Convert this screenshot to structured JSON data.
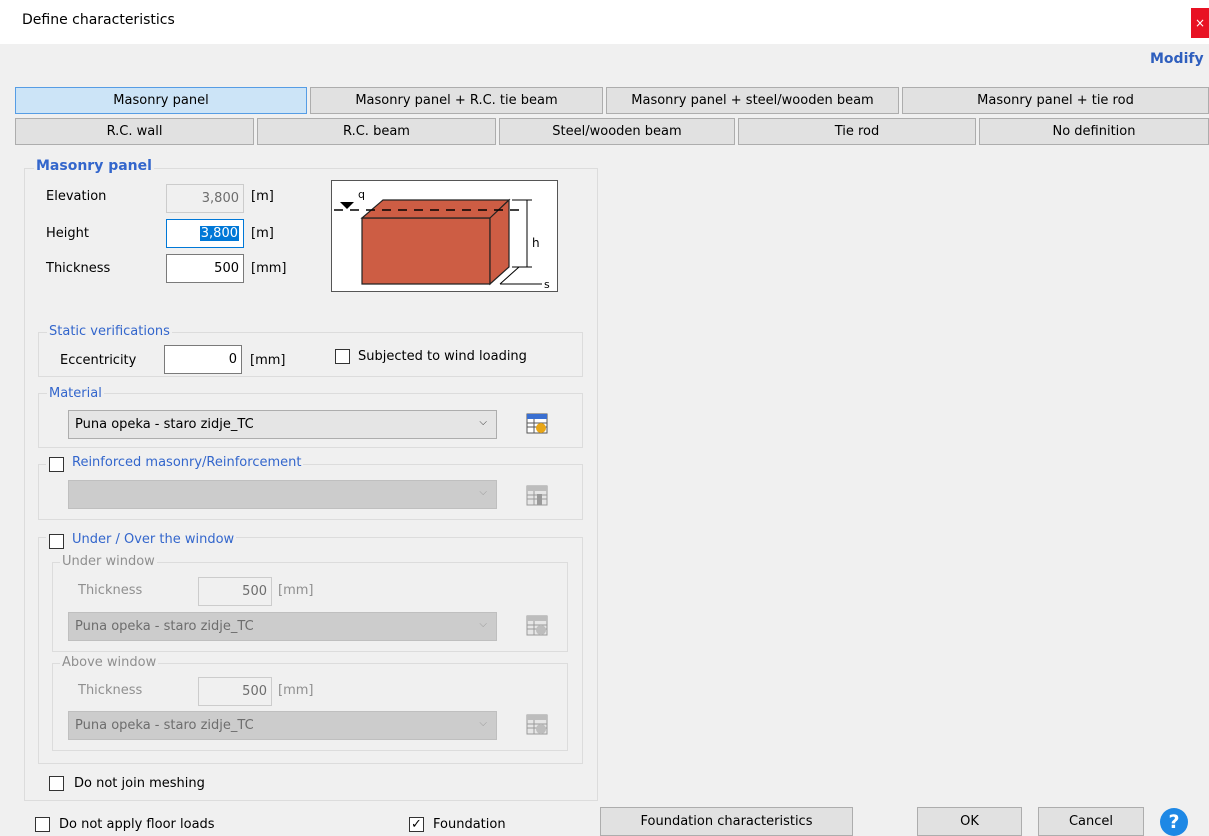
{
  "window": {
    "title": "Define characteristics",
    "close_symbol": "×"
  },
  "header": {
    "modify_label": "Modify"
  },
  "tabs_row1": [
    "Masonry panel",
    "Masonry panel + R.C. tie beam",
    "Masonry panel + steel/wooden beam",
    "Masonry panel + tie rod"
  ],
  "tabs_row2": [
    "R.C. wall",
    "R.C. beam",
    "Steel/wooden beam",
    "Tie rod",
    "No definition"
  ],
  "active_tab": "Masonry panel",
  "panel": {
    "legend": "Masonry panel",
    "elevation": {
      "label": "Elevation",
      "value": "3,800",
      "unit": "[m]"
    },
    "height": {
      "label": "Height",
      "value": "3,800",
      "unit": "[m]"
    },
    "thickness": {
      "label": "Thickness",
      "value": "500",
      "unit": "[mm]"
    },
    "diagram": {
      "q_label": "q",
      "h_label": "h",
      "s_label": "s",
      "brick_color": "#cd5d44"
    }
  },
  "static": {
    "legend": "Static verifications",
    "eccentricity": {
      "label": "Eccentricity",
      "value": "0",
      "unit": "[mm]"
    },
    "wind": {
      "label": "Subjected to wind loading",
      "checked": false
    }
  },
  "material": {
    "legend": "Material",
    "selected": "Puna opeka - staro zidje_TC"
  },
  "reinforced": {
    "label": "Reinforced masonry/Reinforcement",
    "checked": false,
    "selected": ""
  },
  "window_section": {
    "label": "Under / Over the window",
    "checked": false,
    "under": {
      "legend": "Under window",
      "thickness_label": "Thickness",
      "value": "500",
      "unit": "[mm]",
      "material": "Puna opeka - staro zidje_TC"
    },
    "above": {
      "legend": "Above window",
      "thickness_label": "Thickness",
      "value": "500",
      "unit": "[mm]",
      "material": "Puna opeka - staro zidje_TC"
    }
  },
  "meshing": {
    "label": "Do not join meshing",
    "checked": false
  },
  "footer": {
    "floor_loads": {
      "label": "Do not apply floor loads",
      "checked": false
    },
    "foundation": {
      "label": "Foundation",
      "checked": true,
      "check_mark": "✓"
    },
    "foundation_button": "Foundation characteristics",
    "ok": "OK",
    "cancel": "Cancel",
    "help_symbol": "?"
  },
  "colors": {
    "accent": "#3366cc",
    "active_tab": "#cce4f7",
    "close": "#e81123",
    "help": "#1e88e5"
  }
}
